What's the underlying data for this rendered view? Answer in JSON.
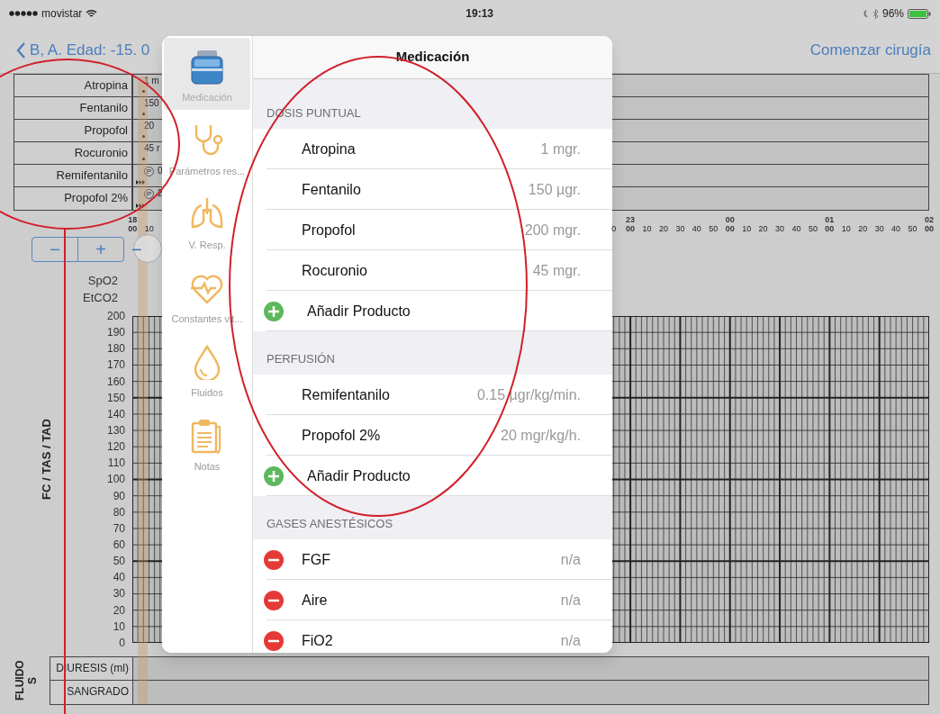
{
  "status_bar": {
    "carrier": "movistar",
    "time": "19:13",
    "battery": "96%"
  },
  "nav": {
    "back_label": "B, A. Edad: -15. 0",
    "action": "Comenzar cirugía"
  },
  "drug_rows": [
    {
      "name": "Atropina",
      "kind": "bolus",
      "value": "1 m"
    },
    {
      "name": "Fentanilo",
      "kind": "bolus",
      "value": "150"
    },
    {
      "name": "Propofol",
      "kind": "bolus",
      "value": "20"
    },
    {
      "name": "Rocuronio",
      "kind": "bolus",
      "value": "45 r"
    },
    {
      "name": "Remifentanilo",
      "kind": "perfusion",
      "badge": "P",
      "value": "0"
    },
    {
      "name": "Propofol 2%",
      "kind": "perfusion",
      "badge": "P",
      "value": "2"
    }
  ],
  "time_axis": {
    "left": [
      {
        "hour": "18",
        "minute": "00"
      },
      {
        "minute": "10"
      }
    ],
    "right": [
      {
        "minute": "0"
      },
      {
        "hour": "23",
        "minute": "00"
      },
      {
        "minute": "10"
      },
      {
        "minute": "20"
      },
      {
        "minute": "30"
      },
      {
        "minute": "40"
      },
      {
        "minute": "50"
      },
      {
        "hour": "00",
        "minute": "00"
      },
      {
        "minute": "10"
      },
      {
        "minute": "20"
      },
      {
        "minute": "30"
      },
      {
        "minute": "40"
      },
      {
        "minute": "50"
      },
      {
        "hour": "01",
        "minute": "00"
      },
      {
        "minute": "10"
      },
      {
        "minute": "20"
      },
      {
        "minute": "30"
      },
      {
        "minute": "40"
      },
      {
        "minute": "50"
      },
      {
        "hour": "02",
        "minute": "00"
      }
    ]
  },
  "zoom_controls": [
    "−",
    "+",
    "−"
  ],
  "series_labels": [
    "SpO2",
    "EtCO2"
  ],
  "chart": {
    "axis_title": "FC / TAS / TAD",
    "y_labels": [
      "200",
      "190",
      "180",
      "170",
      "160",
      "150",
      "140",
      "130",
      "120",
      "110",
      "100",
      "90",
      "80",
      "70",
      "60",
      "50",
      "40",
      "30",
      "20",
      "10",
      "0"
    ]
  },
  "fluids": {
    "label": "FLUIDO S",
    "rows": [
      "DIURESIS (ml)",
      "SANGRADO"
    ]
  },
  "popover": {
    "title": "Medicación",
    "sidebar": [
      {
        "label": "Medicación",
        "kind": "medication",
        "selected": true
      },
      {
        "label": "Parámetros res...",
        "kind": "stethoscope",
        "selected": false
      },
      {
        "label": "V. Resp.",
        "kind": "lungs",
        "selected": false
      },
      {
        "label": "Constantes vit...",
        "kind": "heart",
        "selected": false
      },
      {
        "label": "Fluidos",
        "kind": "drop",
        "selected": false
      },
      {
        "label": "Notas",
        "kind": "clipboard",
        "selected": false
      }
    ],
    "sections": [
      {
        "title": "DOSIS PUNTUAL",
        "items": [
          {
            "kind": "item",
            "name": "Atropina",
            "value": "1 mgr."
          },
          {
            "kind": "item",
            "name": "Fentanilo",
            "value": "150 µgr."
          },
          {
            "kind": "item",
            "name": "Propofol",
            "value": "200 mgr."
          },
          {
            "kind": "item",
            "name": "Rocuronio",
            "value": "45 mgr."
          },
          {
            "kind": "add",
            "name": "Añadir Producto"
          }
        ]
      },
      {
        "title": "PERFUSIÓN",
        "items": [
          {
            "kind": "item",
            "name": "Remifentanilo",
            "value": "0.15 µgr/kg/min."
          },
          {
            "kind": "item",
            "name": "Propofol 2%",
            "value": "20 mgr/kg/h."
          },
          {
            "kind": "add",
            "name": "Añadir Producto"
          }
        ]
      },
      {
        "title": "GASES ANESTÉSICOS",
        "items": [
          {
            "kind": "remove",
            "name": "FGF",
            "value": "n/a"
          },
          {
            "kind": "remove",
            "name": "Aire",
            "value": "n/a"
          },
          {
            "kind": "remove",
            "name": "FiO2",
            "value": "n/a"
          }
        ]
      }
    ]
  }
}
